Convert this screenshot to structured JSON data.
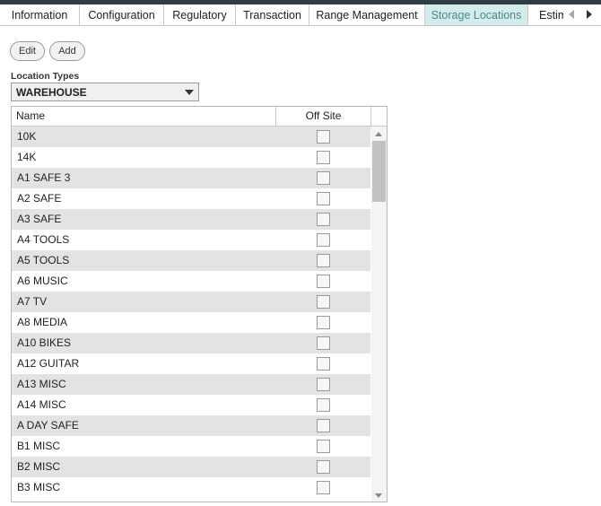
{
  "tabs": [
    {
      "label": "Information",
      "active": false
    },
    {
      "label": "Configuration",
      "active": false
    },
    {
      "label": "Regulatory",
      "active": false
    },
    {
      "label": "Transaction",
      "active": false
    },
    {
      "label": "Range Management",
      "active": false
    },
    {
      "label": "Storage Locations",
      "active": true
    },
    {
      "label": "Estim",
      "active": false
    }
  ],
  "toolbar": {
    "edit_label": "Edit",
    "add_label": "Add"
  },
  "location_types": {
    "label": "Location Types",
    "selected": "WAREHOUSE"
  },
  "grid": {
    "columns": {
      "name": "Name",
      "off_site": "Off Site"
    },
    "rows": [
      {
        "name": "10K",
        "off_site": false
      },
      {
        "name": "14K",
        "off_site": false
      },
      {
        "name": "A1 SAFE 3",
        "off_site": false
      },
      {
        "name": "A2 SAFE",
        "off_site": false
      },
      {
        "name": "A3 SAFE",
        "off_site": false
      },
      {
        "name": "A4 TOOLS",
        "off_site": false
      },
      {
        "name": "A5 TOOLS",
        "off_site": false
      },
      {
        "name": "A6 MUSIC",
        "off_site": false
      },
      {
        "name": "A7 TV",
        "off_site": false
      },
      {
        "name": "A8 MEDIA",
        "off_site": false
      },
      {
        "name": "A10 BIKES",
        "off_site": false
      },
      {
        "name": "A12 GUITAR",
        "off_site": false
      },
      {
        "name": "A13 MISC",
        "off_site": false
      },
      {
        "name": "A14 MISC",
        "off_site": false
      },
      {
        "name": "A DAY SAFE",
        "off_site": false
      },
      {
        "name": "B1 MISC",
        "off_site": false
      },
      {
        "name": "B2 MISC",
        "off_site": false
      },
      {
        "name": "B3 MISC",
        "off_site": false
      }
    ]
  },
  "colors": {
    "active_tab_bg": "#d4ecea",
    "active_tab_text": "#4a8a86",
    "row_alt_bg": "#e3e3e3",
    "top_bar": "#2f3e46"
  }
}
